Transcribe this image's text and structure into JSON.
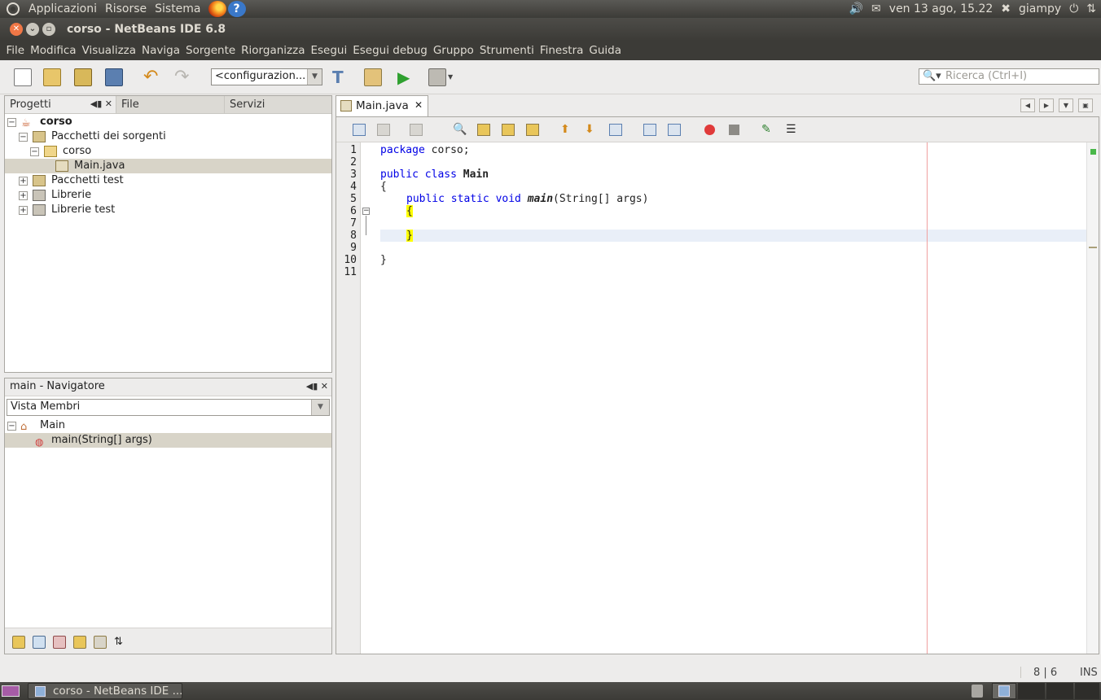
{
  "top_panel": {
    "menus": [
      "Applicazioni",
      "Risorse",
      "Sistema"
    ],
    "datetime": "ven 13 ago, 15.22",
    "user": "giampy"
  },
  "window": {
    "title": "corso - NetBeans IDE 6.8"
  },
  "menubar": [
    "File",
    "Modifica",
    "Visualizza",
    "Naviga",
    "Sorgente",
    "Riorganizza",
    "Esegui",
    "Esegui debug",
    "Gruppo",
    "Strumenti",
    "Finestra",
    "Guida"
  ],
  "toolbar": {
    "config_value": "<configurazion...",
    "search_placeholder": "Ricerca (Ctrl+I)"
  },
  "projects": {
    "tabs": [
      "Progetti",
      "File",
      "Servizi"
    ],
    "tree": [
      {
        "label": "corso",
        "bold": true
      },
      {
        "label": "Pacchetti dei sorgenti"
      },
      {
        "label": "corso"
      },
      {
        "label": "Main.java",
        "selected": true
      },
      {
        "label": "Pacchetti test"
      },
      {
        "label": "Librerie"
      },
      {
        "label": "Librerie test"
      }
    ]
  },
  "navigator": {
    "title": "main - Navigatore",
    "view": "Vista Membri",
    "tree": [
      {
        "label": "Main"
      },
      {
        "label": "main(String[] args)",
        "selected": true
      }
    ]
  },
  "editor": {
    "tab_label": "Main.java",
    "line_numbers": [
      "1",
      "2",
      "3",
      "4",
      "5",
      "6",
      "7",
      "8",
      "9",
      "10",
      "11"
    ],
    "code": {
      "l1_kw": "package",
      "l1_rest": " corso;",
      "l3_kw": "public class",
      "l3_name": "Main",
      "l4": "{",
      "l5_kw": "public static void",
      "l5_method": "main",
      "l5_rest": "(String[] args)",
      "l6": "{",
      "l8": "}",
      "l10": "}"
    }
  },
  "status": {
    "position": "8 | 6",
    "mode": "INS"
  },
  "taskbar": {
    "window_button": "corso - NetBeans IDE ..."
  }
}
